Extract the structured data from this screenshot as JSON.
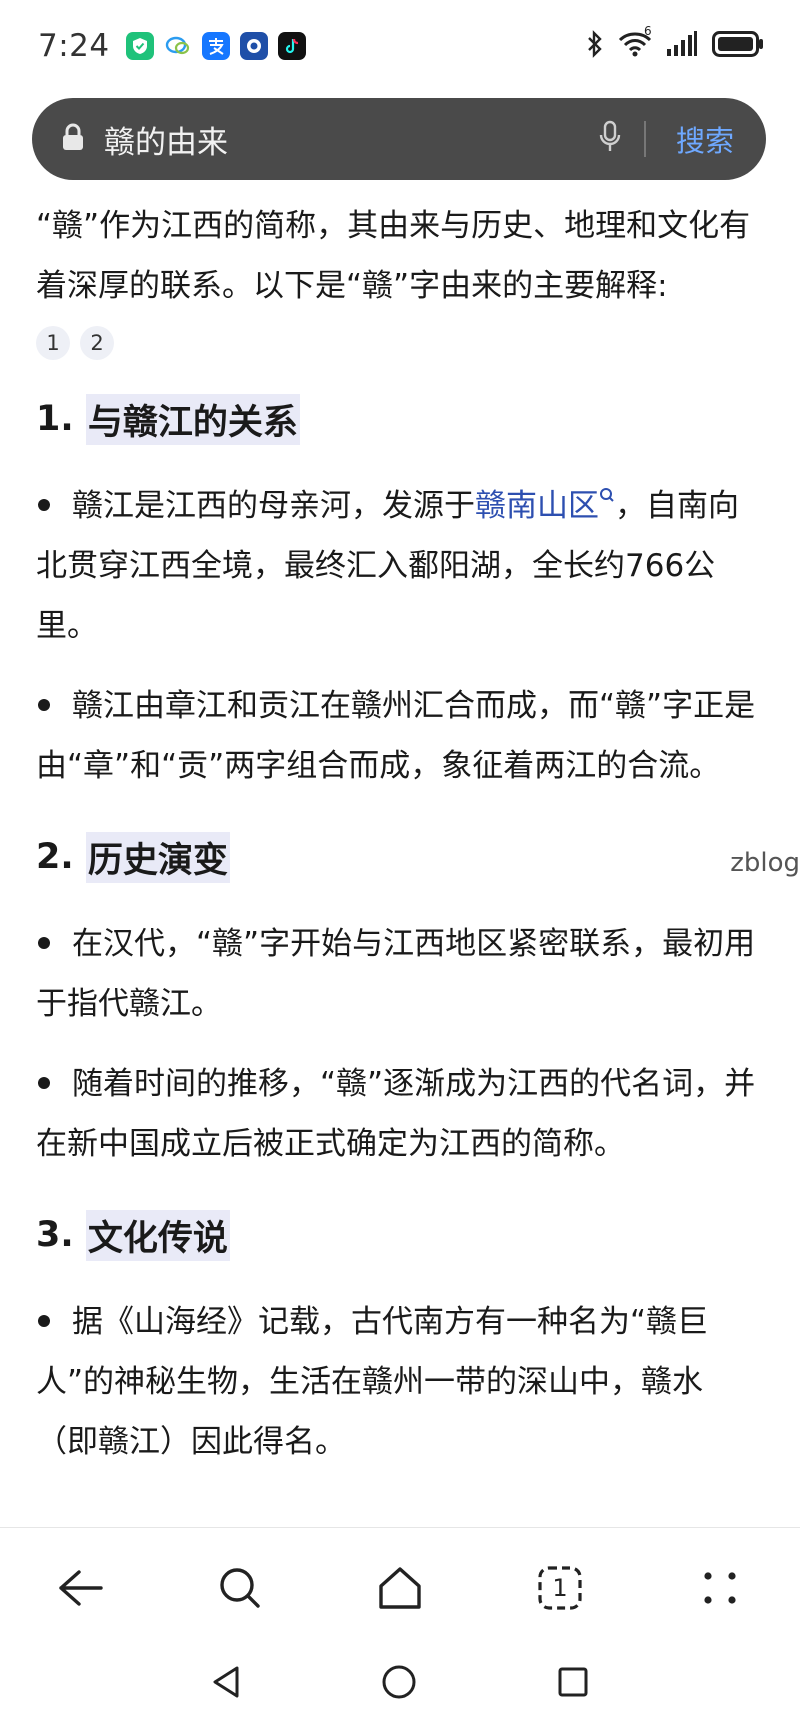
{
  "status_bar": {
    "time": "7:24",
    "signal_badge": "6"
  },
  "search": {
    "query": "赣的由来",
    "button_label": "搜索"
  },
  "answer": {
    "intro": "“赣”作为江西的简称，其由来与历史、地理和文化有着深厚的联系。以下是“赣”字由来的主要解释:",
    "refs": [
      "1",
      "2"
    ],
    "sections": [
      {
        "number": "1.",
        "title": "与赣江的关系",
        "bullets": [
          {
            "before": "赣江是江西的母亲河，发源于",
            "link": "赣南山区",
            "after": "，自南向北贯穿江西全境，最终汇入鄱阳湖，全长约766公里。"
          },
          {
            "text": "赣江由章江和贡江在赣州汇合而成，而“赣”字正是由“章”和“贡”两字组合而成，象征着两江的合流。"
          }
        ]
      },
      {
        "number": "2.",
        "title": "历史演变",
        "bullets": [
          {
            "text": "在汉代，“赣”字开始与江西地区紧密联系，最初用于指代赣江。"
          },
          {
            "text": "随着时间的推移，“赣”逐渐成为江西的代名词，并在新中国成立后被正式确定为江西的简称。"
          }
        ]
      },
      {
        "number": "3.",
        "title": "文化传说",
        "bullets": [
          {
            "text": "据《山海经》记载，古代南方有一种名为“赣巨人”的神秘生物，生活在赣州一带的深山中，赣水（即赣江）因此得名。"
          }
        ]
      }
    ]
  },
  "watermark": "zblog",
  "nav": {
    "tab_count": "1"
  },
  "colors": {
    "link": "#2d4fb0",
    "search_button": "#6ea8ff",
    "heading_highlight": "#e9eaf7",
    "search_bar_bg": "#4a4a4a"
  }
}
